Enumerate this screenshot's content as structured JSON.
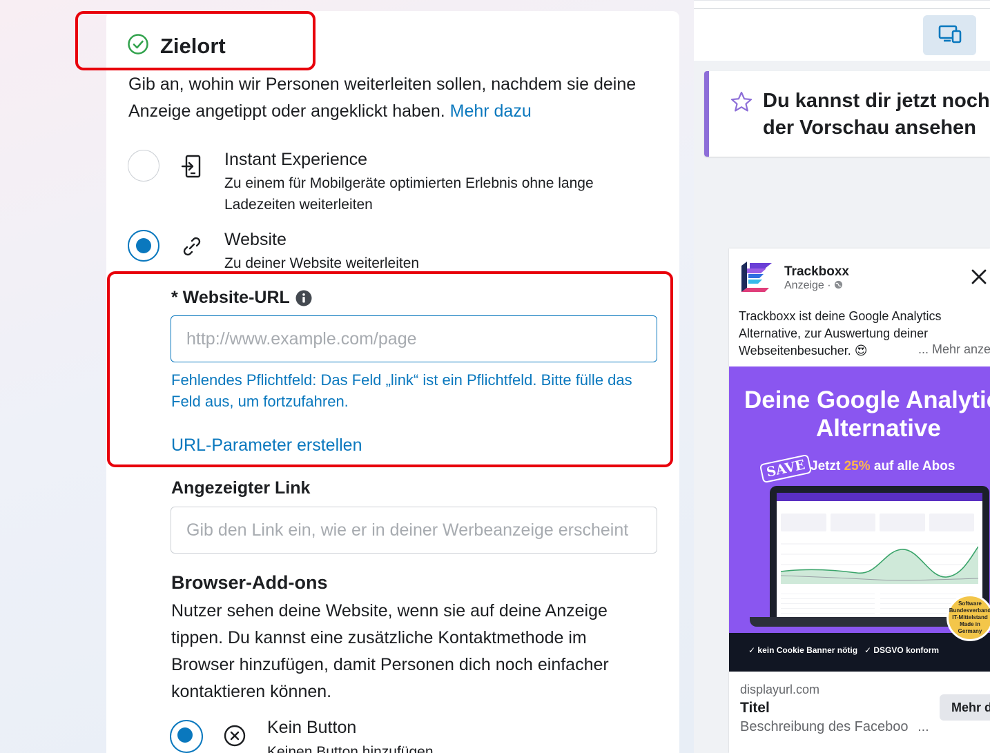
{
  "section": {
    "title": "Zielort",
    "description": "Gib an, wohin wir Personen weiterleiten sollen, nachdem sie deine Anzeige angetippt oder angeklickt haben.",
    "more_link": "Mehr dazu"
  },
  "destination_options": [
    {
      "title": "Instant Experience",
      "subtitle": "Zu einem für Mobilgeräte optimierten Erlebnis ohne lange Ladezeiten weiterleiten",
      "selected": false,
      "icon": "instant-experience-icon"
    },
    {
      "title": "Website",
      "subtitle": "Zu deiner Website weiterleiten",
      "selected": true,
      "icon": "link-icon"
    }
  ],
  "website_url": {
    "label": "* Website-URL",
    "placeholder": "http://www.example.com/page",
    "value": "",
    "error": "Fehlendes Pflichtfeld: Das Feld „link“ ist ein Pflichtfeld. Bitte fülle das Feld aus, um fortzufahren.",
    "params_link": "URL-Parameter erstellen"
  },
  "display_link": {
    "label": "Angezeigter Link",
    "placeholder": "Gib den Link ein, wie er in deiner Werbeanzeige erscheint"
  },
  "browser_addons": {
    "title": "Browser-Add-ons",
    "description": "Nutzer sehen deine Website, wenn sie auf deine Anzeige tippen. Du kannst eine zusätzliche Kontaktmethode im Browser hinzufügen, damit Personen dich noch einfacher kontaktieren können.",
    "options": [
      {
        "title": "Kein Button",
        "subtitle": "Keinen Button hinzufügen",
        "selected": true
      }
    ]
  },
  "preview": {
    "notice": "Du kannst dir jetzt noch mehr der Vorschau ansehen",
    "notice_line1": "Du kannst dir jetzt noch m",
    "notice_line2": "der Vorschau ansehen",
    "ad": {
      "brand": "Trackboxx",
      "sponsored": "Anzeige · ",
      "body_line1": "Trackboxx ist deine Google Analytics",
      "body_line2": "Alternative, zur Auswertung deiner",
      "body_line3": "Webseitenbesucher. 😍",
      "more": "... Mehr anzeigen",
      "headline_line1": "Deine Google Analytics",
      "headline_line2": "Alternative",
      "save_stamp": "SAVE",
      "promo_pre": "Jetzt ",
      "promo_pct": "25%",
      "promo_post": " auf alle Abos",
      "feature_1": "kein Cookie Banner nötig",
      "feature_2": "DSGVO konform",
      "badge": "Software Bundesverband IT-Mittelstand Made in Germany",
      "display_url": "displayurl.com",
      "title": "Titel",
      "description": "Beschreibung des Faceboo",
      "description_ellipsis": "...",
      "cta": "Mehr dazu"
    }
  },
  "colors": {
    "accent": "#0a78be",
    "error_box": "#e8000b",
    "success": "#31a24c",
    "creative_bg": "#8a56f0"
  }
}
